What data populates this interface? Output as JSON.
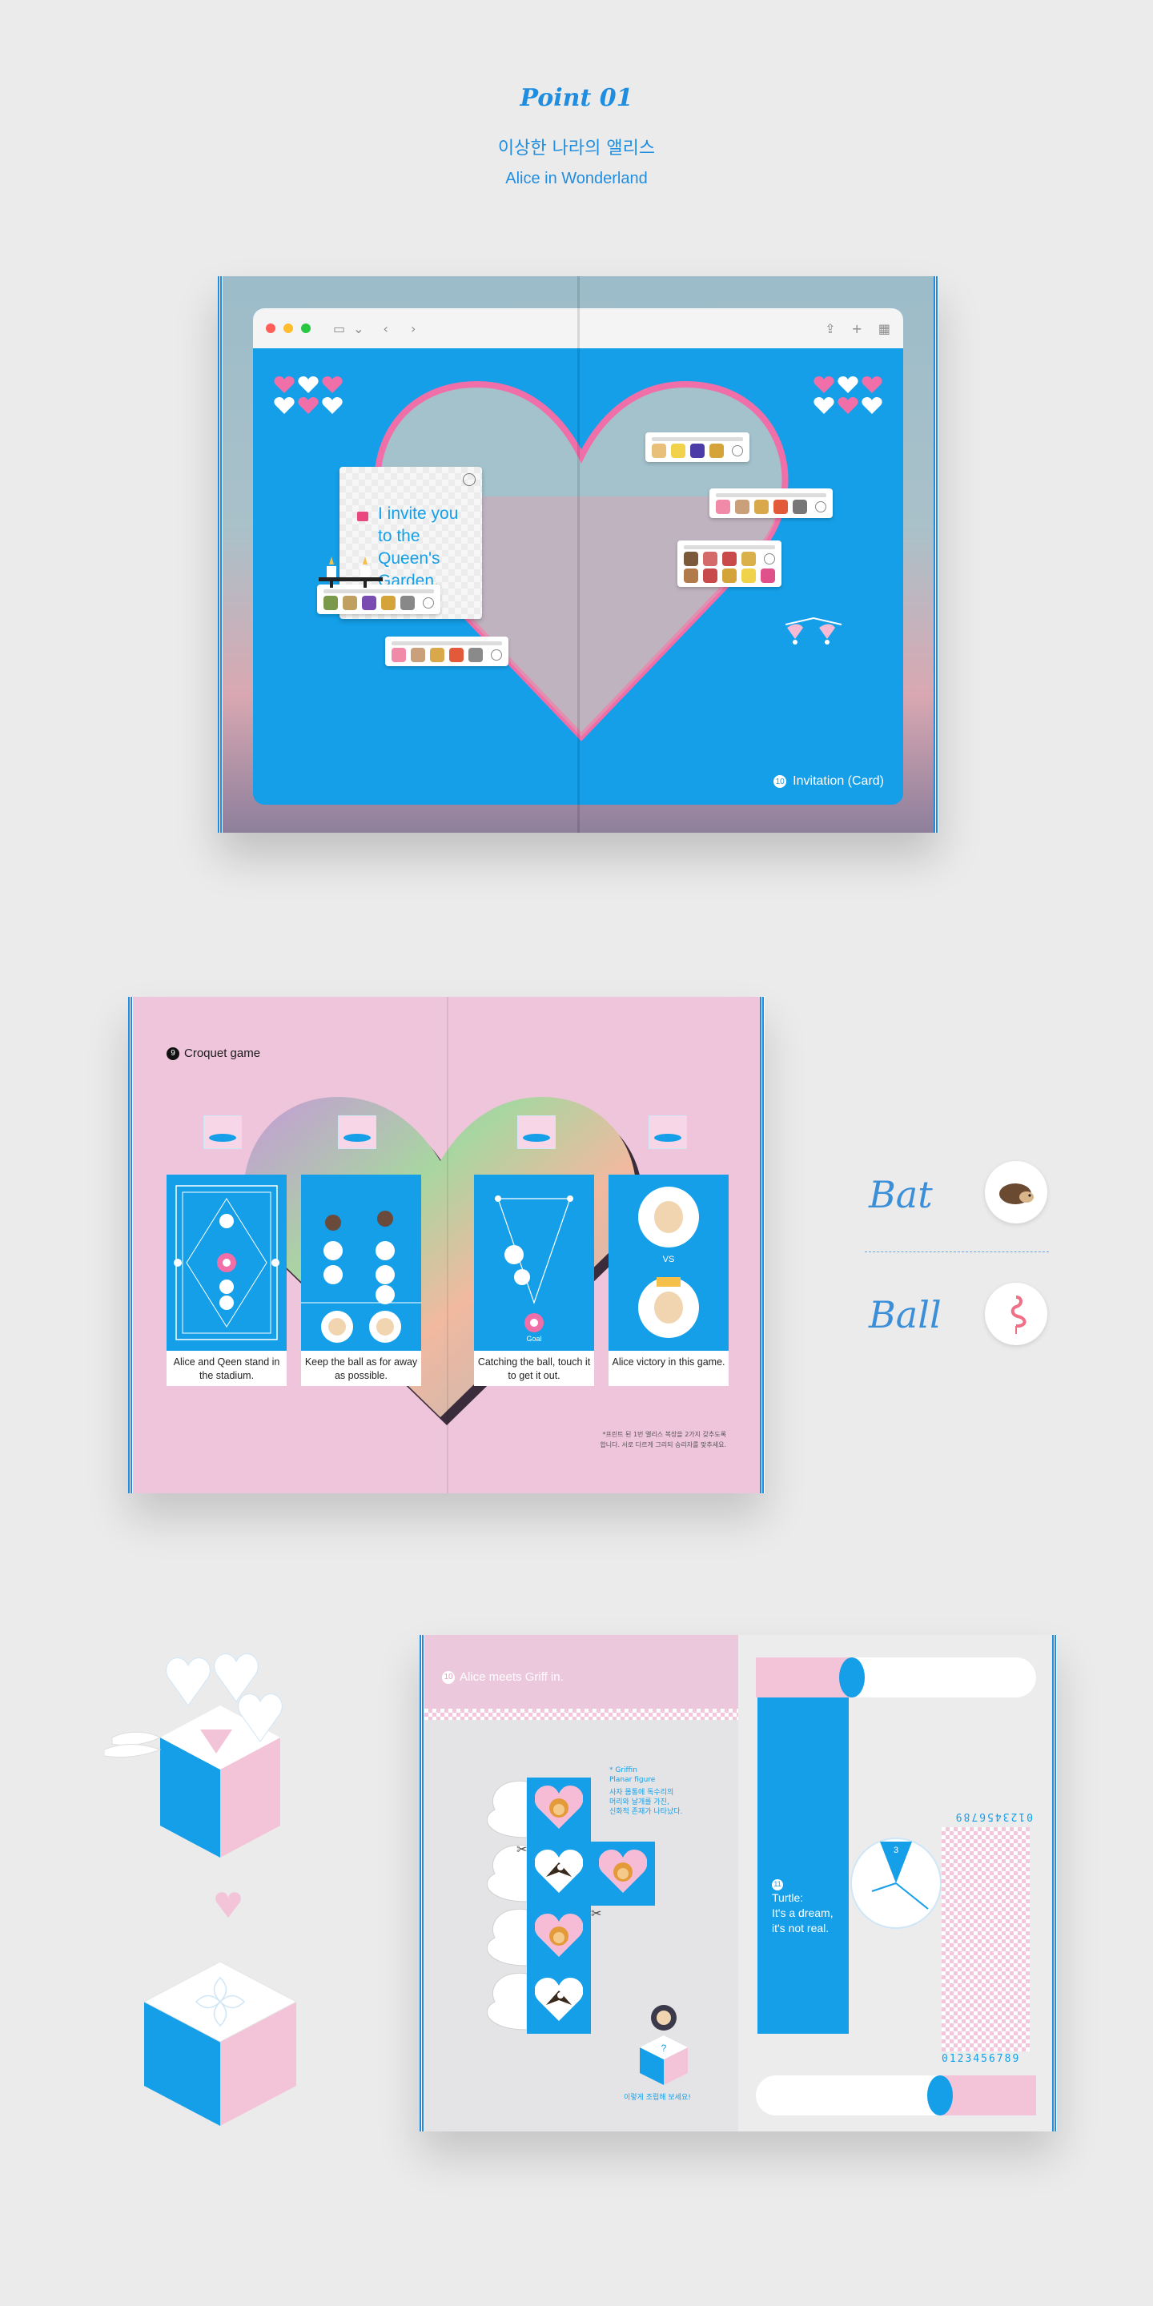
{
  "header": {
    "point": "Point 01",
    "title_kr": "이상한 나라의 앨리스",
    "title_en": "Alice in Wonderland"
  },
  "invitation": {
    "card_text": "I invite you to the Queen's Garden.",
    "badge_number": "10",
    "badge_label": "Invitation (Card)"
  },
  "croquet": {
    "page_number": "9",
    "title": "Croquet game",
    "panels": [
      {
        "caption": "Alice and Qeen stand in the stadium."
      },
      {
        "caption": "Keep the ball as for away as possible."
      },
      {
        "caption": "Catching the ball, touch it to get it out."
      },
      {
        "caption": "Alice victory in this game."
      }
    ],
    "vs_label": "VS",
    "goal_label": "Goal",
    "footnote": "*프린트 된 1번 앨리스 복장을 2가지 갖추도록\n합니다. 서로 다르게 그리되 승리자를 맞추세요."
  },
  "legend": {
    "bat_label": "Bat",
    "ball_label": "Ball",
    "bat_icon": "hedgehog-icon",
    "ball_icon": "flamingo-icon"
  },
  "griffin": {
    "page_number": "10",
    "title": "Alice meets Griff in.",
    "note_title": "* Griffin",
    "note_sub": "Planar figure",
    "note_kr": "사자 몸통에 독수리의\n머리와 날개를 가진,\n신화적 존재가 나타났다.",
    "bottom_note": "이렇게 조립해 보세요!",
    "turtle_number": "11",
    "turtle_line1": "Turtle:",
    "turtle_line2": "It's a dream,",
    "turtle_line3": "it's not real.",
    "digits_top": "0123456789",
    "digits_bottom": "0123456789",
    "clock_number": "3"
  },
  "colors": {
    "accent_blue": "#149fe8",
    "pink": "#eec5db",
    "heart_pink": "#f06fa8"
  }
}
